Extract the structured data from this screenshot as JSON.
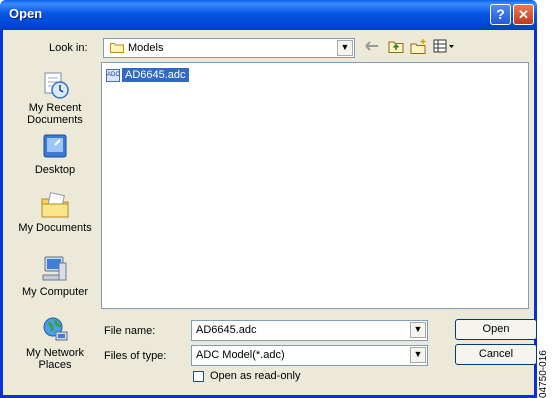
{
  "dialog": {
    "title": "Open",
    "help_button": "?",
    "close_button": "✕"
  },
  "look_in": {
    "label": "Look in:",
    "value": "Models"
  },
  "toolbar": {
    "icons": [
      "back-arrow-icon",
      "up-folder-icon",
      "new-folder-icon",
      "views-menu-icon"
    ]
  },
  "places": [
    {
      "label": "My Recent Documents",
      "icon": "recent-documents-icon"
    },
    {
      "label": "Desktop",
      "icon": "desktop-icon"
    },
    {
      "label": "My Documents",
      "icon": "my-documents-icon"
    },
    {
      "label": "My Computer",
      "icon": "my-computer-icon"
    },
    {
      "label": "My Network Places",
      "icon": "network-places-icon"
    }
  ],
  "files": [
    {
      "name": "AD6645.adc",
      "selected": true
    }
  ],
  "file_name": {
    "label": "File name:",
    "value": "AD6645.adc"
  },
  "file_type": {
    "label": "Files of type:",
    "value": "ADC Model(*.adc)"
  },
  "buttons": {
    "open": "Open",
    "cancel": "Cancel"
  },
  "read_only": {
    "label": "Open as read-only",
    "checked": false
  },
  "figure_id": "04750-016",
  "colors": {
    "title_bar": "#0055e5",
    "selection": "#316ac5",
    "window_bg": "#ece9d8"
  }
}
